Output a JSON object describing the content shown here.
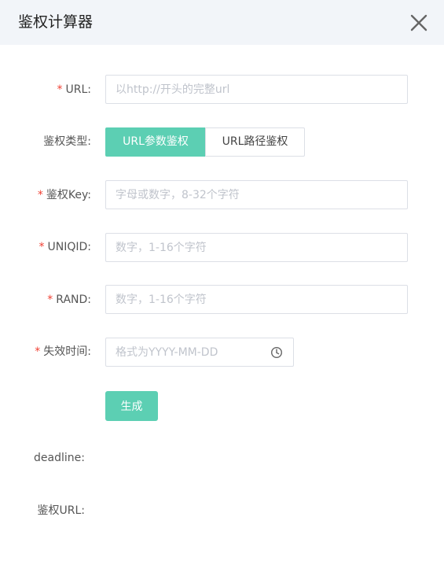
{
  "dialog": {
    "title": "鉴权计算器",
    "close_icon": "close-icon"
  },
  "form": {
    "url": {
      "required_mark": "*",
      "label": "URL:",
      "placeholder": "以http://开头的完整url",
      "value": ""
    },
    "auth_type": {
      "label": "鉴权类型:",
      "options": [
        "URL参数鉴权",
        "URL路径鉴权"
      ],
      "selected": "URL参数鉴权"
    },
    "auth_key": {
      "required_mark": "*",
      "label": "鉴权Key:",
      "placeholder": "字母或数字，8-32个字符",
      "value": ""
    },
    "uniqid": {
      "required_mark": "*",
      "label": "UNIQID:",
      "placeholder": "数字，1-16个字符",
      "value": ""
    },
    "rand": {
      "required_mark": "*",
      "label": "RAND:",
      "placeholder": "数字，1-16个字符",
      "value": ""
    },
    "expire": {
      "required_mark": "*",
      "label": "失效时间:",
      "placeholder": "格式为YYYY-MM-DD",
      "value": "",
      "icon": "clock-icon"
    },
    "generate_label": "生成"
  },
  "results": {
    "deadline_label": "deadline:",
    "auth_url_label": "鉴权URL:"
  },
  "colors": {
    "accent": "#5ccfb3",
    "required": "#f04134",
    "header_bg": "#f2f5f9"
  }
}
